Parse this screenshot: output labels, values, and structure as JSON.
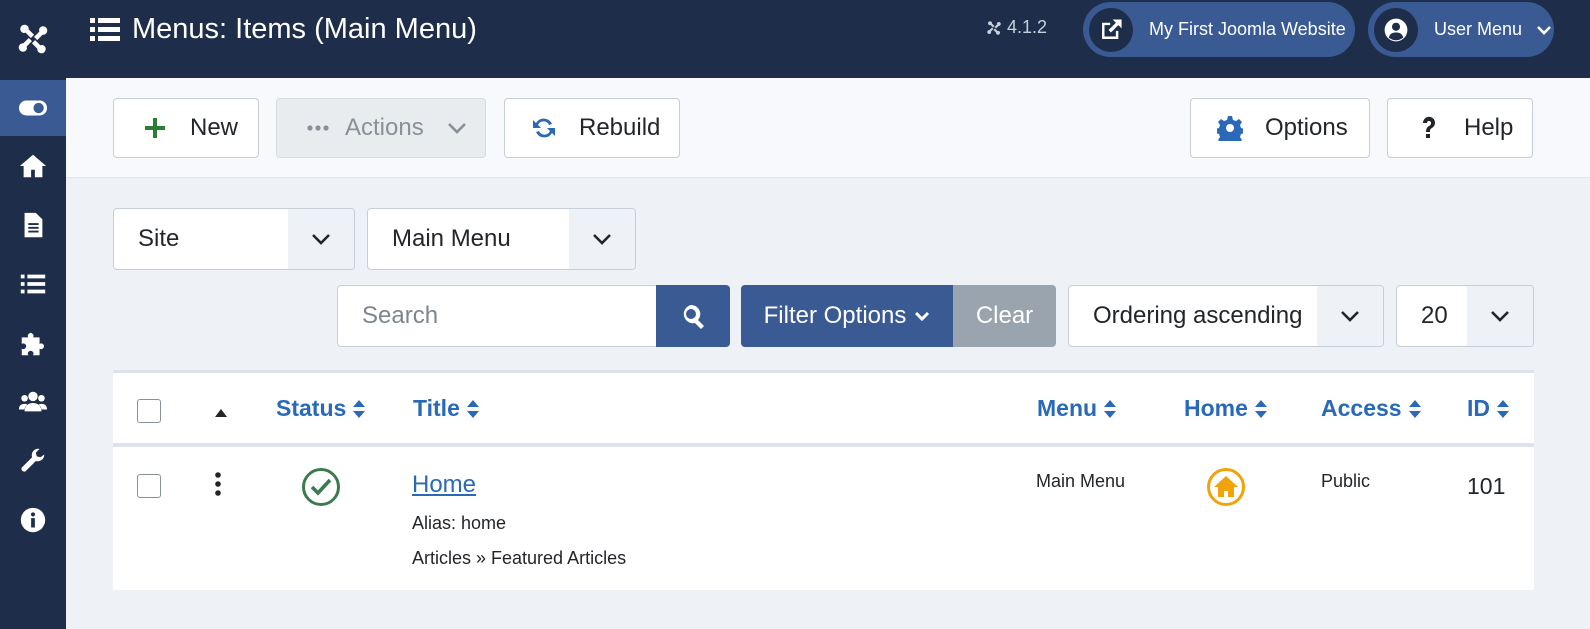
{
  "header": {
    "title": "Menus: Items (Main Menu)",
    "version": "4.1.2",
    "site_link": "My First Joomla Website",
    "user_menu": "User Menu"
  },
  "sidebar": {
    "items": [
      {
        "icon": "toggle-icon",
        "active": true
      },
      {
        "icon": "home-icon"
      },
      {
        "icon": "file-icon"
      },
      {
        "icon": "list-icon"
      },
      {
        "icon": "puzzle-icon"
      },
      {
        "icon": "users-icon"
      },
      {
        "icon": "wrench-icon"
      },
      {
        "icon": "info-icon"
      }
    ]
  },
  "toolbar": {
    "new_label": "New",
    "actions_label": "Actions",
    "rebuild_label": "Rebuild",
    "options_label": "Options",
    "help_label": "Help"
  },
  "filters": {
    "client": "Site",
    "menu": "Main Menu",
    "search_placeholder": "Search",
    "filter_options_label": "Filter Options",
    "clear_label": "Clear",
    "ordering": "Ordering ascending",
    "limit": "20"
  },
  "table": {
    "columns": {
      "status": "Status",
      "title": "Title",
      "menu": "Menu",
      "home": "Home",
      "access": "Access",
      "id": "ID"
    },
    "rows": [
      {
        "title": "Home",
        "alias": "Alias: home",
        "type": "Articles » Featured Articles",
        "menu": "Main Menu",
        "access": "Public",
        "id": "101",
        "published": true,
        "is_home": true
      }
    ]
  },
  "colors": {
    "sidebar_bg": "#1e2d4a",
    "accent": "#3a5a94",
    "link": "#2a69b8",
    "success": "#3d7a4f",
    "home": "#f0a30a"
  }
}
